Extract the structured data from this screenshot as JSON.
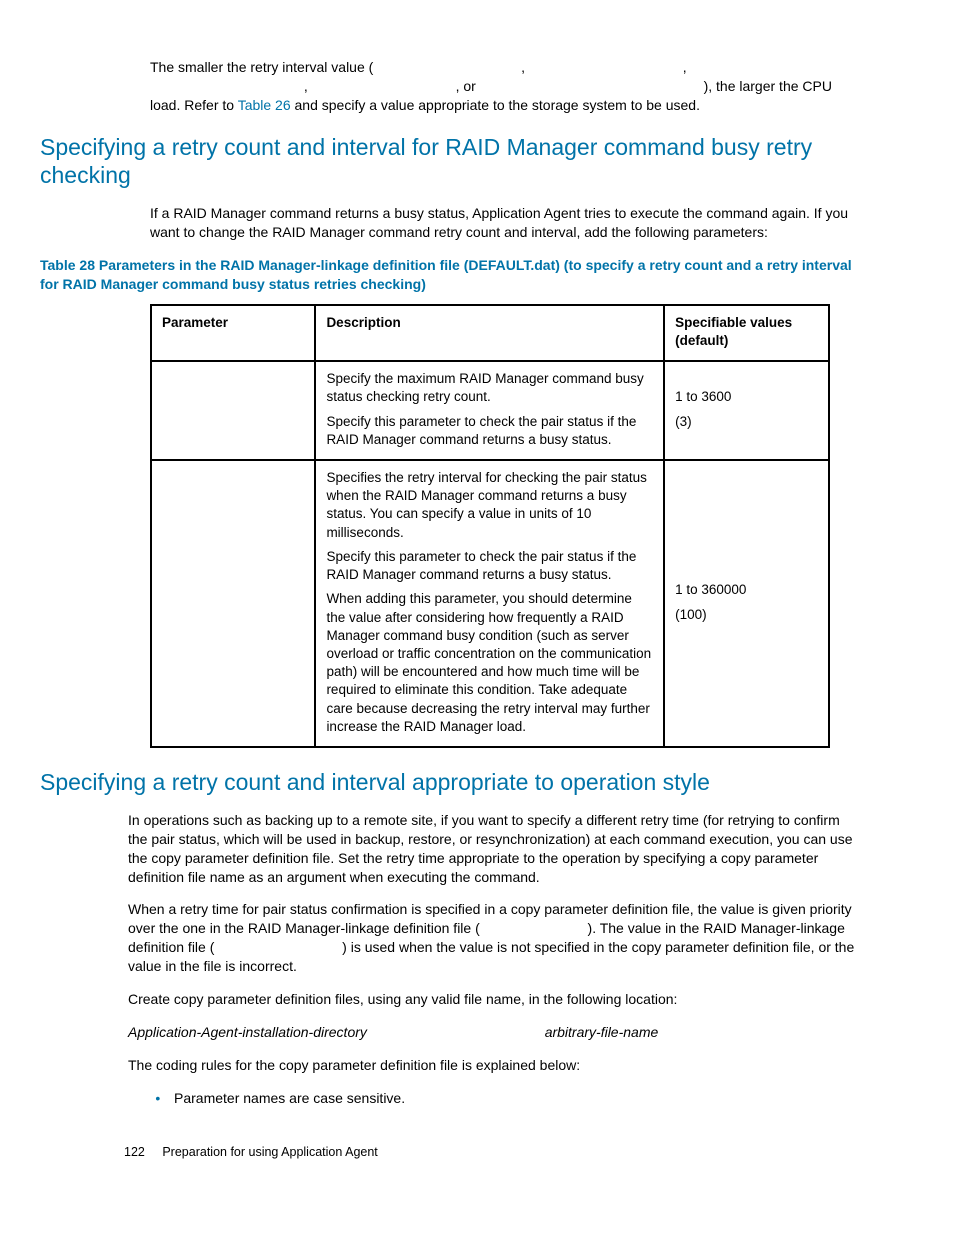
{
  "intro_paragraph_parts": {
    "p1a": "The smaller the retry interval value (",
    "p1b": ",",
    "p1c": ",",
    "p1d": ",",
    "p1e": ", or",
    "p1f": "), the larger the CPU load. Refer to ",
    "link": "Table 26",
    "p1g": " and specify a value appropriate to the storage system to be used."
  },
  "section1_heading": "Specifying a retry count and interval for RAID Manager command busy retry checking",
  "section1_intro": "If a RAID Manager command returns a busy status, Application Agent tries to execute the command again. If you want to change the RAID Manager command retry count and interval, add the following parameters:",
  "table_caption": "Table 28 Parameters in the RAID Manager-linkage definition file (DEFAULT.dat) (to specify a retry count and a retry interval for RAID Manager command busy status retries checking)",
  "table": {
    "headers": {
      "parameter": "Parameter",
      "description": "Description",
      "spec": "Specifiable values (default)"
    },
    "rows": [
      {
        "parameter": "",
        "description": [
          "Specify the maximum RAID Manager command busy status checking retry count.",
          "Specify this parameter to check the pair status if the RAID Manager command returns a busy status."
        ],
        "spec": [
          "1 to 3600",
          "(3)"
        ]
      },
      {
        "parameter": "",
        "description": [
          "Specifies the retry interval for checking the pair status when the RAID Manager command returns a busy status. You can specify a value in units of 10 milliseconds.",
          "Specify this parameter to check the pair status if the RAID Manager command returns a busy status.",
          "When adding this parameter, you should determine the value after considering how frequently a RAID Manager command busy condition (such as server overload or traffic concentration on the communication path) will be encountered and how much time will be required to eliminate this condition. Take adequate care because decreasing the retry interval may further increase the RAID Manager load."
        ],
        "spec": [
          "1 to 360000",
          "(100)"
        ]
      }
    ]
  },
  "section2_heading": "Specifying a retry count and interval appropriate to operation style",
  "section2_p1": "In operations such as backing up to a remote site, if you want to specify a different retry time (for retrying to confirm the pair status, which will be used in backup, restore, or resynchronization) at each command execution, you can use the copy parameter definition file. Set the retry time appropriate to the operation by specifying a copy parameter definition file name as an argument when executing the command.",
  "section2_p2_parts": {
    "a": "When a retry time for pair status confirmation is specified in a copy parameter definition file, the value is given priority over the one in the RAID Manager-linkage definition file (",
    "b": "). The value in the RAID Manager-linkage definition file (",
    "c": ") is used when the value is not specified in the copy parameter definition file, or the value in the file is incorrect."
  },
  "section2_p3": "Create copy parameter definition files, using any valid file name, in the following location:",
  "section2_path_parts": {
    "a": "Application-Agent-installation-directory",
    "b": "arbitrary-file-name"
  },
  "section2_p4": "The coding rules for the copy parameter definition file is explained below:",
  "bullet1": "Parameter names are case sensitive.",
  "footer": {
    "page": "122",
    "title": "Preparation for using Application Agent"
  }
}
